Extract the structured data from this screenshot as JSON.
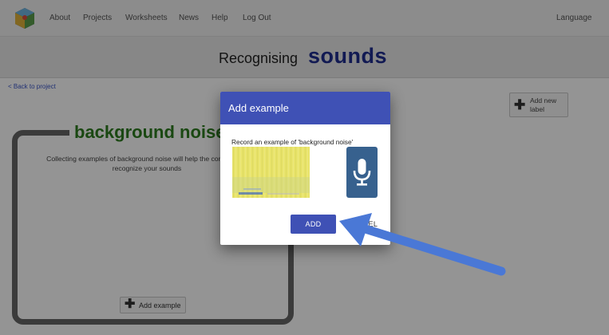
{
  "nav": {
    "items": [
      {
        "label": "About"
      },
      {
        "label": "Projects"
      },
      {
        "label": "Worksheets"
      },
      {
        "label": "News"
      },
      {
        "label": "Help"
      },
      {
        "label": "Log Out"
      }
    ],
    "language": "Language"
  },
  "title": {
    "prefix": "Recognising",
    "main": "sounds"
  },
  "back_link": "< Back to project",
  "add_label_button": {
    "icon": "plus-icon",
    "label": "Add new label"
  },
  "label_card": {
    "title": "background noise",
    "description": "Collecting examples of background noise will help the computer to\nrecognize your sounds",
    "add_example": "Add example"
  },
  "dialog": {
    "title": "Add example",
    "prompt": "Record an example of 'background noise'",
    "mic_icon": "microphone-icon",
    "add_button": "ADD",
    "cancel_button": "CANCEL"
  },
  "colors": {
    "primary": "#3f51b5",
    "title_blue": "#1f2d8f",
    "label_green": "#2e7d1f",
    "mic_blue": "#37618e",
    "arrow_blue": "#4a78d6"
  }
}
